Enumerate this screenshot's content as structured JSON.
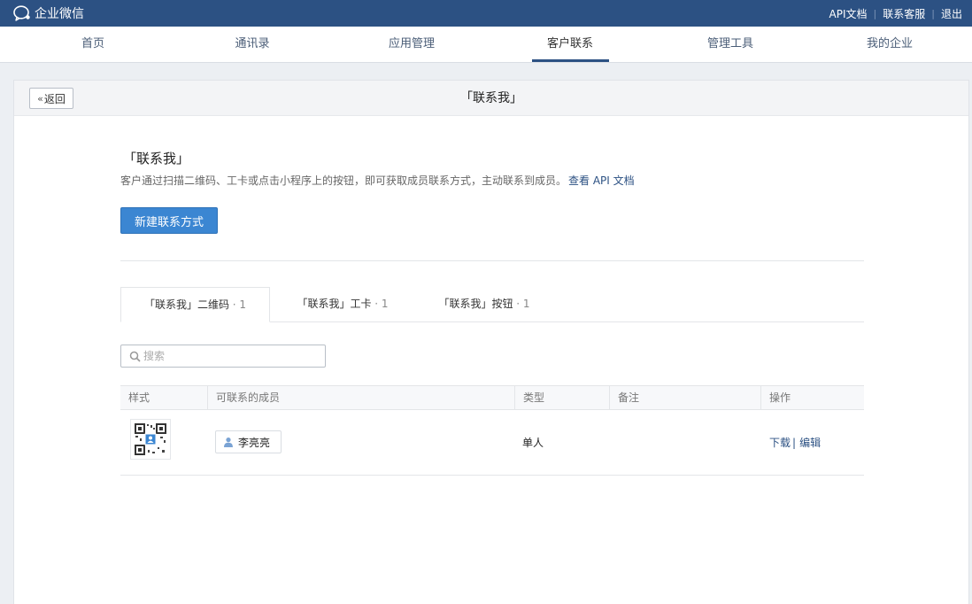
{
  "app": {
    "name": "企业微信"
  },
  "topbar": {
    "links": [
      "API文档",
      "联系客服",
      "退出"
    ]
  },
  "nav": {
    "items": [
      "首页",
      "通讯录",
      "应用管理",
      "客户联系",
      "管理工具",
      "我的企业"
    ],
    "active": "客户联系"
  },
  "header": {
    "back_label": "返回",
    "title": "「联系我」"
  },
  "section": {
    "title": "「联系我」",
    "desc": "客户通过扫描二维码、工卡或点击小程序上的按钮，即可获取成员联系方式，主动联系到成员。",
    "doc_link": "查看 API 文档",
    "create_button": "新建联系方式"
  },
  "tabs": [
    {
      "label": "「联系我」二维码",
      "count": "· 1"
    },
    {
      "label": "「联系我」工卡",
      "count": "· 1"
    },
    {
      "label": "「联系我」按钮",
      "count": "· 1"
    }
  ],
  "search": {
    "placeholder": "搜索"
  },
  "table": {
    "headers": [
      "样式",
      "可联系的成员",
      "类型",
      "备注",
      "操作"
    ],
    "rows": [
      {
        "member": "李亮亮",
        "type": "单人",
        "note": "",
        "actions": [
          "下载",
          "编辑"
        ]
      }
    ]
  },
  "colors": {
    "topbar": "#2c5183",
    "primary": "#3b86d2",
    "link": "#2c5183"
  },
  "icons": [
    "wechat-work-logo-icon",
    "chevron-double-left-icon",
    "search-icon",
    "qr-code-icon",
    "user-icon"
  ]
}
